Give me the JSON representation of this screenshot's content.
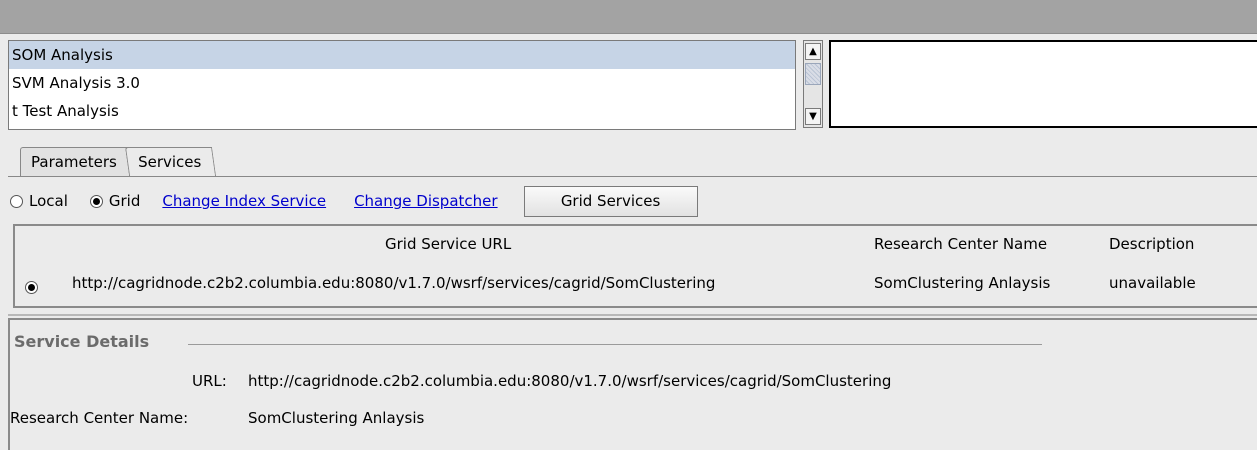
{
  "analysis_list": {
    "items": [
      "SOM Analysis",
      "SVM Analysis 3.0",
      "t Test Analysis"
    ],
    "selected_index": 0
  },
  "tabs": [
    {
      "label": "Parameters",
      "active": false
    },
    {
      "label": "Services",
      "active": true
    }
  ],
  "mode": {
    "local_label": "Local",
    "grid_label": "Grid",
    "selected": "Grid"
  },
  "links": {
    "change_index": "Change Index Service",
    "change_dispatcher": "Change Dispatcher"
  },
  "grid_services_button": "Grid Services",
  "services_table": {
    "columns": [
      "Grid Service URL",
      "Research Center Name",
      "Description"
    ],
    "rows": [
      {
        "selected": true,
        "url": "http://cagridnode.c2b2.columbia.edu:8080/v1.7.0/wsrf/services/cagrid/SomClustering",
        "center": "SomClustering Anlaysis",
        "description": "unavailable"
      }
    ]
  },
  "service_details": {
    "title": "Service Details",
    "url_label": "URL:",
    "url_value": "http://cagridnode.c2b2.columbia.edu:8080/v1.7.0/wsrf/services/cagrid/SomClustering",
    "center_label": "Research Center Name:",
    "center_value": "SomClustering Anlaysis"
  },
  "colors": {
    "selection": "#c6d4e6",
    "link": "#0000cc",
    "titlebar": "#a3a3a3"
  }
}
